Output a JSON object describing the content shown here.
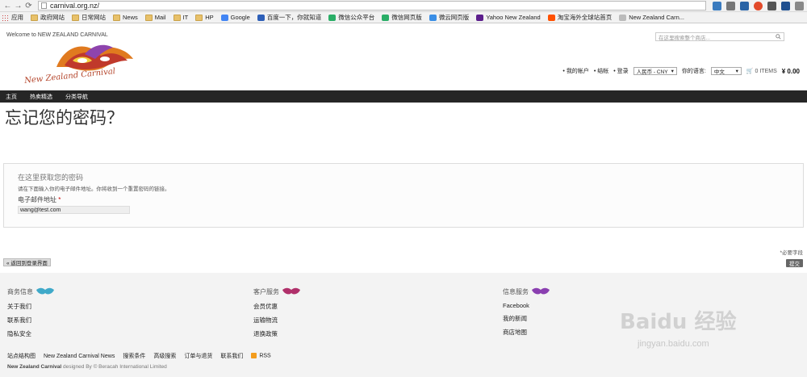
{
  "browser": {
    "url": "carnival.org.nz/",
    "bookmarks": [
      {
        "label": "应用",
        "icon": "apps-grid-icon"
      },
      {
        "label": "政府网站",
        "icon": "folder-icon"
      },
      {
        "label": "日常网站",
        "icon": "folder-icon"
      },
      {
        "label": "News",
        "icon": "folder-icon"
      },
      {
        "label": "Mail",
        "icon": "folder-icon"
      },
      {
        "label": "IT",
        "icon": "folder-icon"
      },
      {
        "label": "HP",
        "icon": "folder-icon"
      },
      {
        "label": "Google",
        "icon": "google-icon"
      },
      {
        "label": "百度一下，你就知道",
        "icon": "baidu-icon"
      },
      {
        "label": "微信公众平台",
        "icon": "wechat-icon"
      },
      {
        "label": "微信网页版",
        "icon": "wechat-icon"
      },
      {
        "label": "微云网页版",
        "icon": "weiyun-icon"
      },
      {
        "label": "Yahoo New Zealand",
        "icon": "yahoo-icon"
      },
      {
        "label": "淘宝海外全球站首页",
        "icon": "taobao-icon"
      },
      {
        "label": "New Zealand Carn...",
        "icon": "page-icon"
      }
    ]
  },
  "header": {
    "welcome": "Welcome to NEW ZEALAND CARNIVAL",
    "logo_text": "New Zealand Carnival",
    "search_placeholder": "在这里搜索整个商店...",
    "my_account": "我的帐户",
    "checkout": "结帐",
    "login": "登录",
    "currency": "人民币 - CNY",
    "language_label": "你的语言:",
    "language": "中文",
    "cart_items": "0 ITEMS",
    "cart_total": "¥ 0.00"
  },
  "nav": [
    "主页",
    "热卖精选",
    "分类导航"
  ],
  "page": {
    "title": "忘记您的密码？",
    "legend": "在这里获取您的密码",
    "hint": "请在下面输入你的电子邮件地址。你将收到一个重置密码的链接。",
    "email_label": "电子邮件地址",
    "required_star": "*",
    "email_value": "wang@test.com",
    "required_note": "*必要字段",
    "back_label": "« 返回到登录界面",
    "submit_label": "提交"
  },
  "footer": {
    "columns": [
      {
        "title": "商务信息",
        "links": [
          "关于我们",
          "联系我们",
          "隐私安全"
        ],
        "mask_color": "#3fa9c9"
      },
      {
        "title": "客户服务",
        "links": [
          "会员优惠",
          "运输物流",
          "退换政策"
        ],
        "mask_color": "#b0306a"
      },
      {
        "title": "信息服务",
        "links": [
          "Facebook",
          "我的新闻",
          "商店地图"
        ],
        "mask_color": "#8a3fb0"
      }
    ],
    "bottom_links": [
      "站点结构图",
      "New Zealand Carnival News",
      "搜索条件",
      "高级搜索",
      "订单与退货",
      "联系我们",
      "RSS"
    ],
    "copyright_brand": "New Zealand Carnival",
    "copyright_rest": " designed By © Beracah International Limited"
  },
  "watermark": {
    "text": "Baidu 经验",
    "url": "jingyan.baidu.com"
  }
}
